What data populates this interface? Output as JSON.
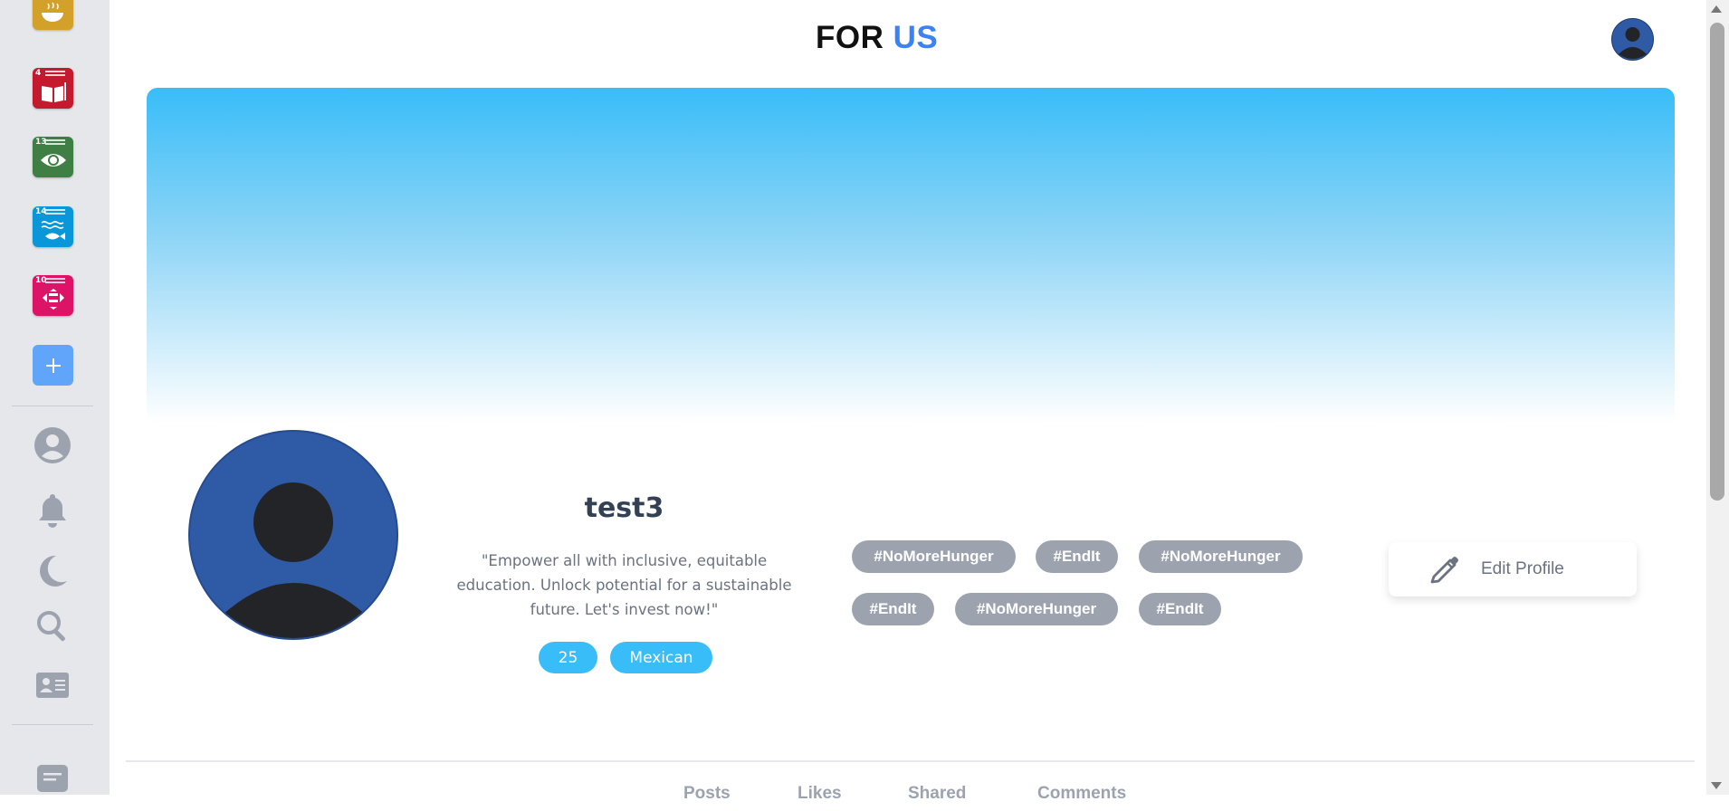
{
  "brand": {
    "part1": "FOR",
    "part2": "US",
    "accent_color": "#3b82f6"
  },
  "sidebar": {
    "goals": [
      {
        "number": "2",
        "color": "#d3a029",
        "icon": "bowl-icon"
      },
      {
        "number": "4",
        "color": "#c5192d",
        "icon": "book-icon"
      },
      {
        "number": "13",
        "color": "#3f7e44",
        "icon": "eye-globe-icon"
      },
      {
        "number": "14",
        "color": "#0a97d9",
        "icon": "fish-icon"
      },
      {
        "number": "10",
        "color": "#dd1367",
        "icon": "equality-icon"
      }
    ],
    "add_icon": "plus-icon",
    "nav_icons": [
      "user-circle-icon",
      "bell-icon",
      "moon-icon",
      "search-icon",
      "id-card-icon",
      "chat-icon"
    ]
  },
  "profile": {
    "username": "test3",
    "bio": "\"Empower all with inclusive, equitable education. Unlock potential for a sustainable future. Let's invest now!\"",
    "age": "25",
    "nationality": "Mexican",
    "tags": [
      "#NoMoreHunger",
      "#EndIt",
      "#NoMoreHunger",
      "#EndIt",
      "#NoMoreHunger",
      "#EndIt"
    ],
    "edit_label": "Edit Profile"
  },
  "tabs": [
    "Posts",
    "Likes",
    "Shared",
    "Comments"
  ],
  "colors": {
    "banner_top": "#38bdf8",
    "pill": "#38bdf8",
    "tag": "#9ca3af",
    "sidebar_bg": "#e5e7eb"
  }
}
